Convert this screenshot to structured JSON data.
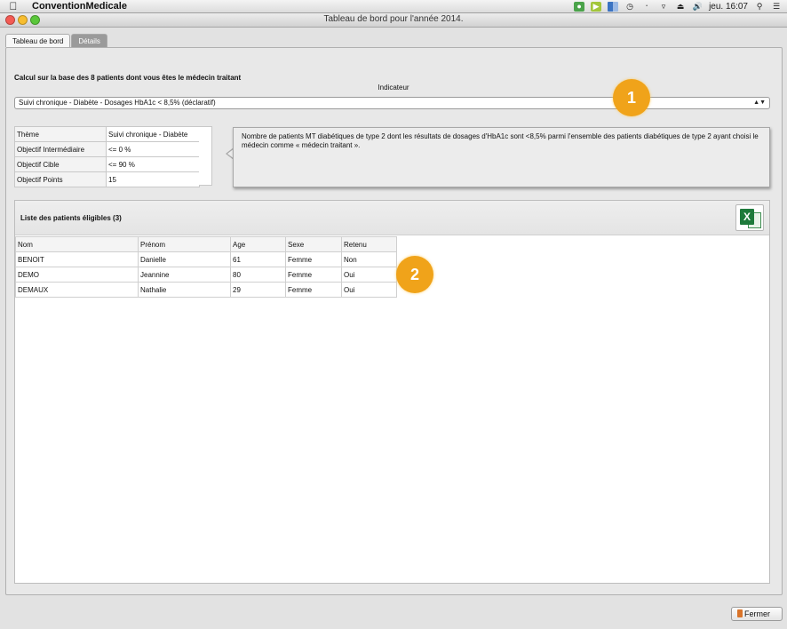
{
  "menubar": {
    "app_name": "ConventionMedicale",
    "clock": "jeu. 16:07",
    "icons": [
      "apple-icon",
      "app-status-icon",
      "play-icon",
      "grid-icon",
      "time-machine-icon",
      "bluetooth-icon",
      "wifi-icon",
      "eject-icon",
      "volume-icon",
      "spotlight-icon",
      "notification-center-icon"
    ]
  },
  "window": {
    "title": "Tableau de bord pour l'année 2014."
  },
  "tabs": [
    {
      "label": "Tableau de bord",
      "active": false
    },
    {
      "label": "Détails",
      "active": true
    }
  ],
  "summary": {
    "calc_label": "Calcul sur la base des 8  patients dont vous êtes le médecin traitant",
    "indicator_label": "Indicateur",
    "indicator_selected": "Suivi chronique - Diabète - Dosages HbA1c < 8,5% (déclaratif)"
  },
  "info": {
    "rows": [
      {
        "key": "Thème",
        "value": "Suivi chronique - Diabète"
      },
      {
        "key": "Objectif Intermédiaire",
        "value": "<= 0 %"
      },
      {
        "key": "Objectif Cible",
        "value": "<= 90 %"
      },
      {
        "key": "Objectif Points",
        "value": "15"
      }
    ],
    "description": "Nombre de patients MT diabétiques de type 2 dont les résultats de dosages d'HbA1c sont <8,5% parmi l'ensemble des patients diabétiques de type 2 ayant choisi le médecin comme « médecin traitant »."
  },
  "patients": {
    "title": "Liste des patients éligibles (3)",
    "columns": [
      "Nom",
      "Prénom",
      "Age",
      "Sexe",
      "Retenu"
    ],
    "rows": [
      [
        "BENOIT",
        "Danielle",
        "61",
        "Femme",
        "Non"
      ],
      [
        "DEMO",
        "Jeannine",
        "80",
        "Femme",
        "Oui"
      ],
      [
        "DEMAUX",
        "Nathalie",
        "29",
        "Femme",
        "Oui"
      ]
    ]
  },
  "callouts": [
    "1",
    "2"
  ],
  "footer": {
    "close_label": "Fermer"
  },
  "colors": {
    "callout": "#f0a31a",
    "excel_green": "#1e7a3b"
  }
}
